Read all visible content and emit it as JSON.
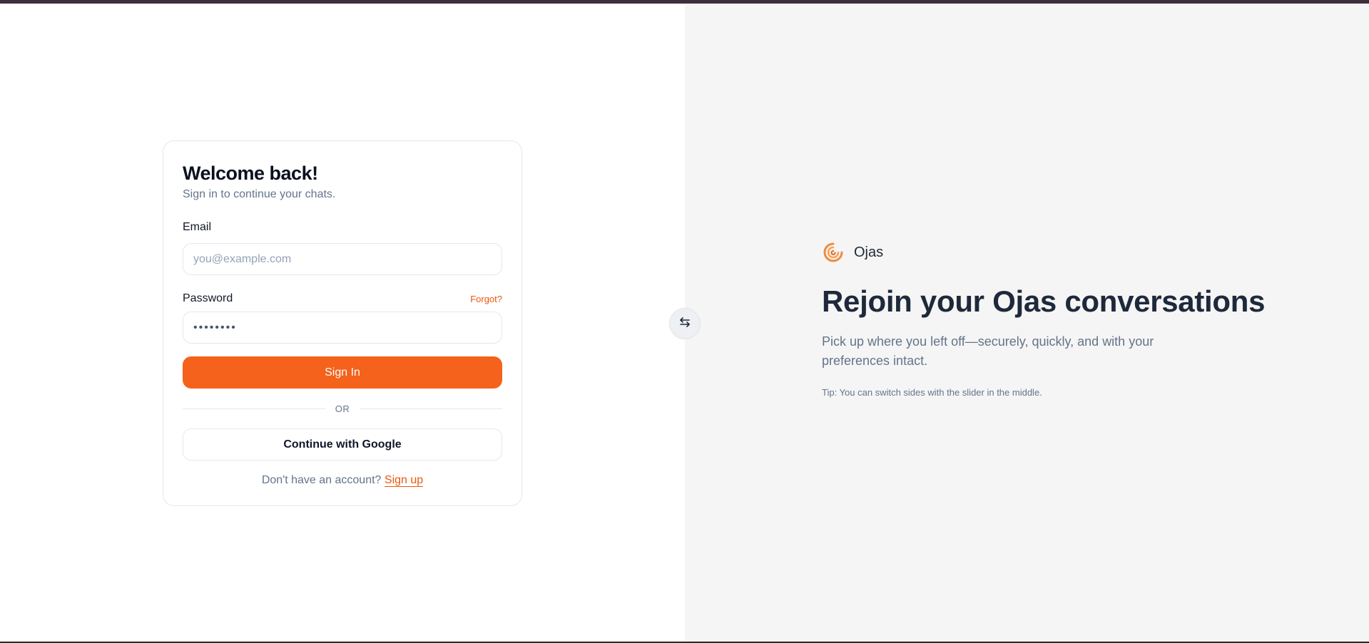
{
  "login": {
    "title": "Welcome back!",
    "subtitle": "Sign in to continue your chats.",
    "email_label": "Email",
    "email_placeholder": "you@example.com",
    "email_value": "",
    "password_label": "Password",
    "forgot_label": "Forgot?",
    "password_value": "password",
    "sign_in_label": "Sign In",
    "divider_label": "OR",
    "google_label": "Continue with Google",
    "signup_prompt": "Don't have an account? ",
    "signup_link": "Sign up"
  },
  "slider": {
    "icon": "swap-arrows-icon"
  },
  "promo": {
    "brand_name": "Ojas",
    "brand_icon": "ojas-swirl-logo",
    "title": "Rejoin your Ojas conversations",
    "description": "Pick up where you left off—securely, quickly, and with your preferences intact.",
    "tip": "Tip: You can switch sides with the slider in the middle."
  },
  "colors": {
    "accent": "#f4621b",
    "link": "#ea580c",
    "right_panel_bg": "#f5f5f5",
    "top_strip": "#3d2f3c"
  }
}
